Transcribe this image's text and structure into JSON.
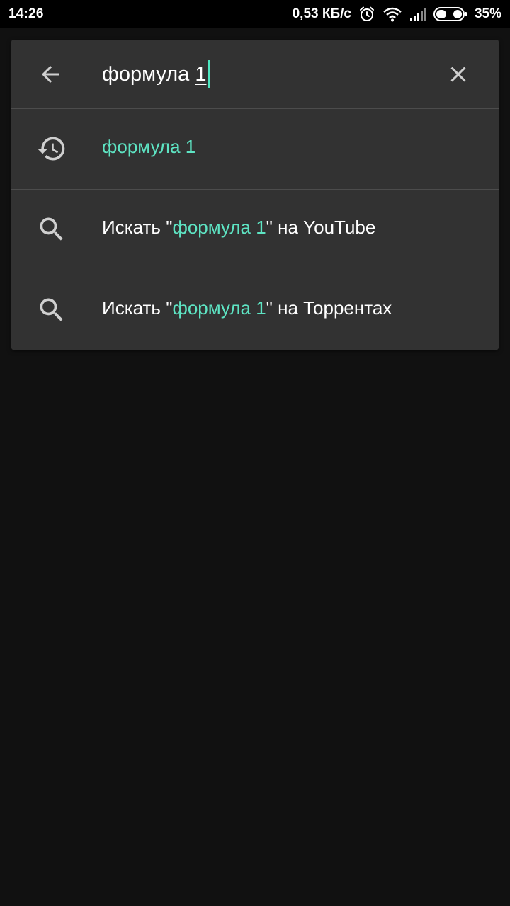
{
  "status_bar": {
    "time": "14:26",
    "network_speed": "0,53 КБ/с",
    "battery_percent": "35%",
    "icons": [
      "alarm-icon",
      "wifi-icon",
      "signal-icon",
      "battery-icon"
    ]
  },
  "search": {
    "query_prefix": "формула ",
    "query_last": "1",
    "back_icon": "arrow-left-icon",
    "clear_icon": "close-icon"
  },
  "suggestions": [
    {
      "icon": "history-icon",
      "text": "формула 1"
    },
    {
      "icon": "search-icon",
      "before": "Искать \"",
      "highlight": "формула 1",
      "after": "\" на YouTube"
    },
    {
      "icon": "search-icon",
      "before": "Искать \"",
      "highlight": "формула 1",
      "after": "\" на Торрентах"
    }
  ],
  "colors": {
    "accent": "#5ee4c3",
    "card": "#323232",
    "background": "#111111",
    "status_bar": "#000000"
  }
}
